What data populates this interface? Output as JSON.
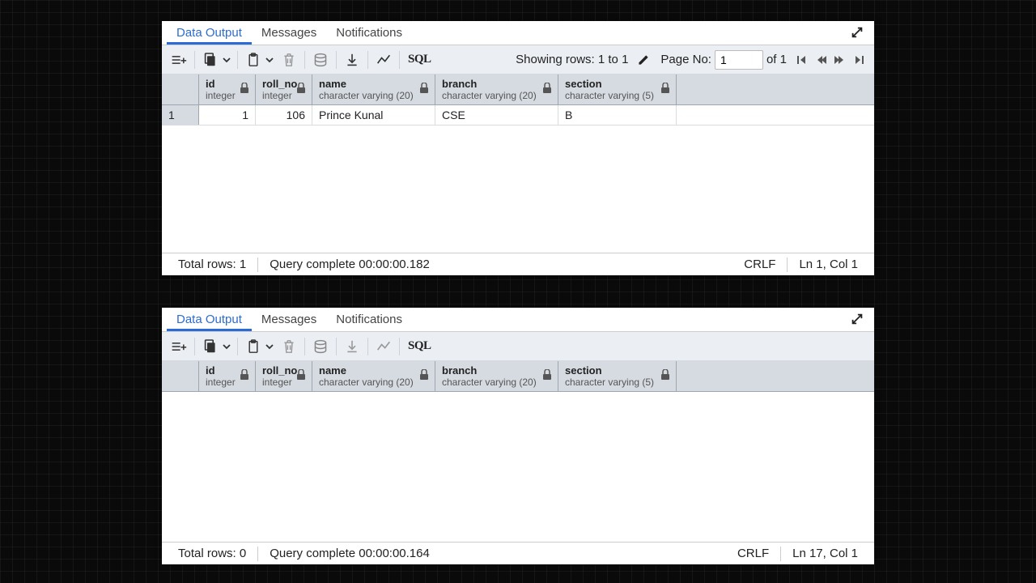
{
  "tabs": {
    "data_output": "Data Output",
    "messages": "Messages",
    "notifications": "Notifications"
  },
  "toolbar": {
    "rows_info": "Showing rows: 1 to 1",
    "page_label": "Page No:",
    "page_value": "1",
    "of_pages": "of 1",
    "sql_label": "SQL"
  },
  "columns": [
    {
      "name": "id",
      "type": "integer"
    },
    {
      "name": "roll_no",
      "type": "integer"
    },
    {
      "name": "name",
      "type": "character varying (20)"
    },
    {
      "name": "branch",
      "type": "character varying (20)"
    },
    {
      "name": "section",
      "type": "character varying (5)"
    }
  ],
  "panel1": {
    "rows": [
      {
        "num": "1",
        "id": "1",
        "roll_no": "106",
        "name": "Prince Kunal",
        "branch": "CSE",
        "section": "B"
      }
    ],
    "status": {
      "total_rows": "Total rows: 1",
      "query_complete": "Query complete 00:00:00.182",
      "crlf": "CRLF",
      "lncol": "Ln 1, Col 1"
    }
  },
  "panel2": {
    "status": {
      "total_rows": "Total rows: 0",
      "query_complete": "Query complete 00:00:00.164",
      "crlf": "CRLF",
      "lncol": "Ln 17, Col 1"
    }
  }
}
